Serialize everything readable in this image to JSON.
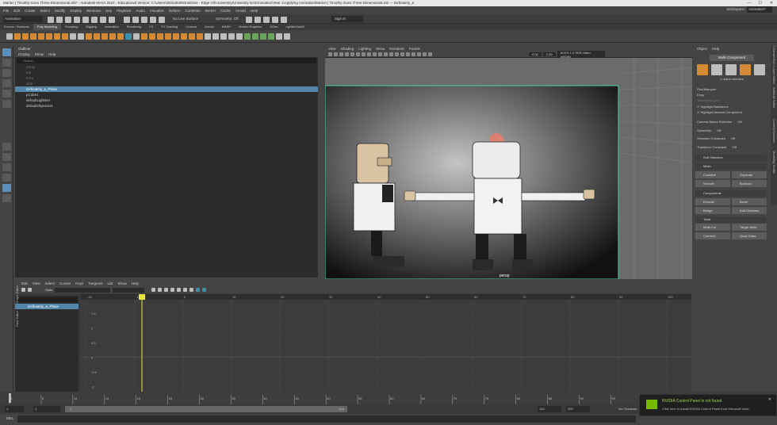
{
  "title_bar": {
    "text": "Marlon | Timothy Goes Three-Dimensional.mb* - Autodesk MAYA 2023 - Educational Version: C:\\Users\\25024849\\OneDrive - Edge Hill University\\University lect\\Animation\\Year 1\\Applying Animation\\Marlon | Timothy Goes Three-Dimensional.mb  ---  Definately_a",
    "minimize": "—",
    "maximize": "☐",
    "close": "✕"
  },
  "menubar": {
    "items": [
      "File",
      "Edit",
      "Create",
      "Select",
      "Modify",
      "Display",
      "Windows",
      "Key",
      "Playback",
      "Audio",
      "Visualize",
      "Deform",
      "Constrain",
      "MASH",
      "Cache",
      "Arnold",
      "Help"
    ],
    "workspace_label": "Workspace:",
    "workspace_value": "Animation*"
  },
  "status_line": {
    "mode": "Animation",
    "no_live": "No Live Surface",
    "symmetry": "Symmetry: Off",
    "sign_in": "Sign In"
  },
  "shelf_tabs": [
    "Curves / Surfaces",
    "Poly Modeling",
    "Sculpting",
    "Rigging",
    "Animation",
    "Rendering",
    "FX",
    "FX Caching",
    "Custom",
    "Arnold",
    "MASH",
    "Motion Graphics",
    "XGen",
    "ngSkinTools2"
  ],
  "shelf_active": "Poly Modeling",
  "outliner": {
    "title": "Outliner",
    "menu": [
      "Display",
      "Show",
      "Help"
    ],
    "search_placeholder": "Search...",
    "items": [
      {
        "label": "persp",
        "state": "dim"
      },
      {
        "label": "top",
        "state": "dim"
      },
      {
        "label": "front",
        "state": "dim"
      },
      {
        "label": "side",
        "state": "dim"
      },
      {
        "label": "Definately_a_Plane",
        "state": "sel"
      },
      {
        "label": "pCube1",
        "state": ""
      },
      {
        "label": "defaultLightSet",
        "state": ""
      },
      {
        "label": "defaultObjectSet",
        "state": ""
      }
    ]
  },
  "viewport": {
    "menu": [
      "View",
      "Shading",
      "Lighting",
      "Show",
      "Renderer",
      "Panels"
    ],
    "field1": "0.00",
    "field2": "1.00",
    "colorspace": "ACES 1.0 SDR-video (sRGB)",
    "camera_label": "persp"
  },
  "right_panel": {
    "tabs": [
      "Object",
      "Help"
    ],
    "mode_title": "Multi-Component",
    "selected_count": "1 object selected",
    "pick_options": [
      "Pick/Marquee",
      "Drag",
      "Tweak/Marquee"
    ],
    "checkboxes": [
      {
        "label": "Highlight Backfaces",
        "checked": true
      },
      {
        "label": "Highlight Nearest Component",
        "checked": true
      }
    ],
    "camera_based": "Camera Based Selection",
    "camera_based_value": "Off",
    "symmetry": "Symmetry",
    "symmetry_value": "Off",
    "selection_constraint": "Selection Constraint",
    "selection_constraint_value": "Off",
    "transform_constraint": "Transform Constraint",
    "transform_constraint_value": "Off",
    "soft_selection": "Soft Selection",
    "sections": {
      "mesh": {
        "title": "Mesh",
        "buttons": [
          "Combine",
          "Separate",
          "Smooth",
          "Boolean"
        ]
      },
      "components": {
        "title": "Components",
        "buttons": [
          "Extrude",
          "Bevel",
          "Bridge",
          "Add Divisions"
        ]
      },
      "tools": {
        "title": "Tools",
        "buttons": [
          "Multi-Cut",
          "Target Weld",
          "Connect",
          "Quad Draw"
        ]
      }
    },
    "side_tabs": [
      "Channel Box / Layer Editor",
      "Attribute Editor",
      "Content Browser",
      "Modeling Toolkit",
      "Attribute Editor"
    ]
  },
  "graph_editor": {
    "menu": [
      "Edit",
      "View",
      "Select",
      "Curves",
      "Keys",
      "Tangents",
      "List",
      "Show",
      "Help"
    ],
    "stats_label": "Stats",
    "outliner_item": "Definately_a_Plane",
    "ruler_ticks": [
      "-15",
      "-10",
      "0",
      "10",
      "20",
      "30",
      "40",
      "50",
      "60",
      "70",
      "80",
      "90",
      "100",
      "110",
      "120"
    ],
    "value_labels": [
      "1.5",
      "1",
      "0.5",
      "0",
      "-0.5",
      "-1",
      "-1.5"
    ],
    "side_labels": [
      "Graph Editor",
      "Time Editor"
    ]
  },
  "timeline": {
    "ticks": [
      "1",
      "5",
      "10",
      "15",
      "20",
      "25",
      "30",
      "35",
      "40",
      "45",
      "50",
      "55",
      "60",
      "65",
      "70",
      "75",
      "80",
      "85",
      "90",
      "95",
      "100",
      "105",
      "110",
      "115",
      "120"
    ],
    "current_frame": "1"
  },
  "range_slider": {
    "start": "1",
    "start2": "1",
    "inner_start": "1",
    "inner_end": "120",
    "end": "120",
    "end2": "200",
    "no_character": "No Character"
  },
  "command_line": {
    "label": "MEL"
  },
  "notification": {
    "title": "NVIDIA Control Panel is not found",
    "body": "Click here to install NVIDIA Control Panel from Microsoft store.",
    "close": "✕"
  },
  "colors": {
    "accent": "#5285a6",
    "playhead": "#e6e63c",
    "orange": "#d48a35"
  }
}
